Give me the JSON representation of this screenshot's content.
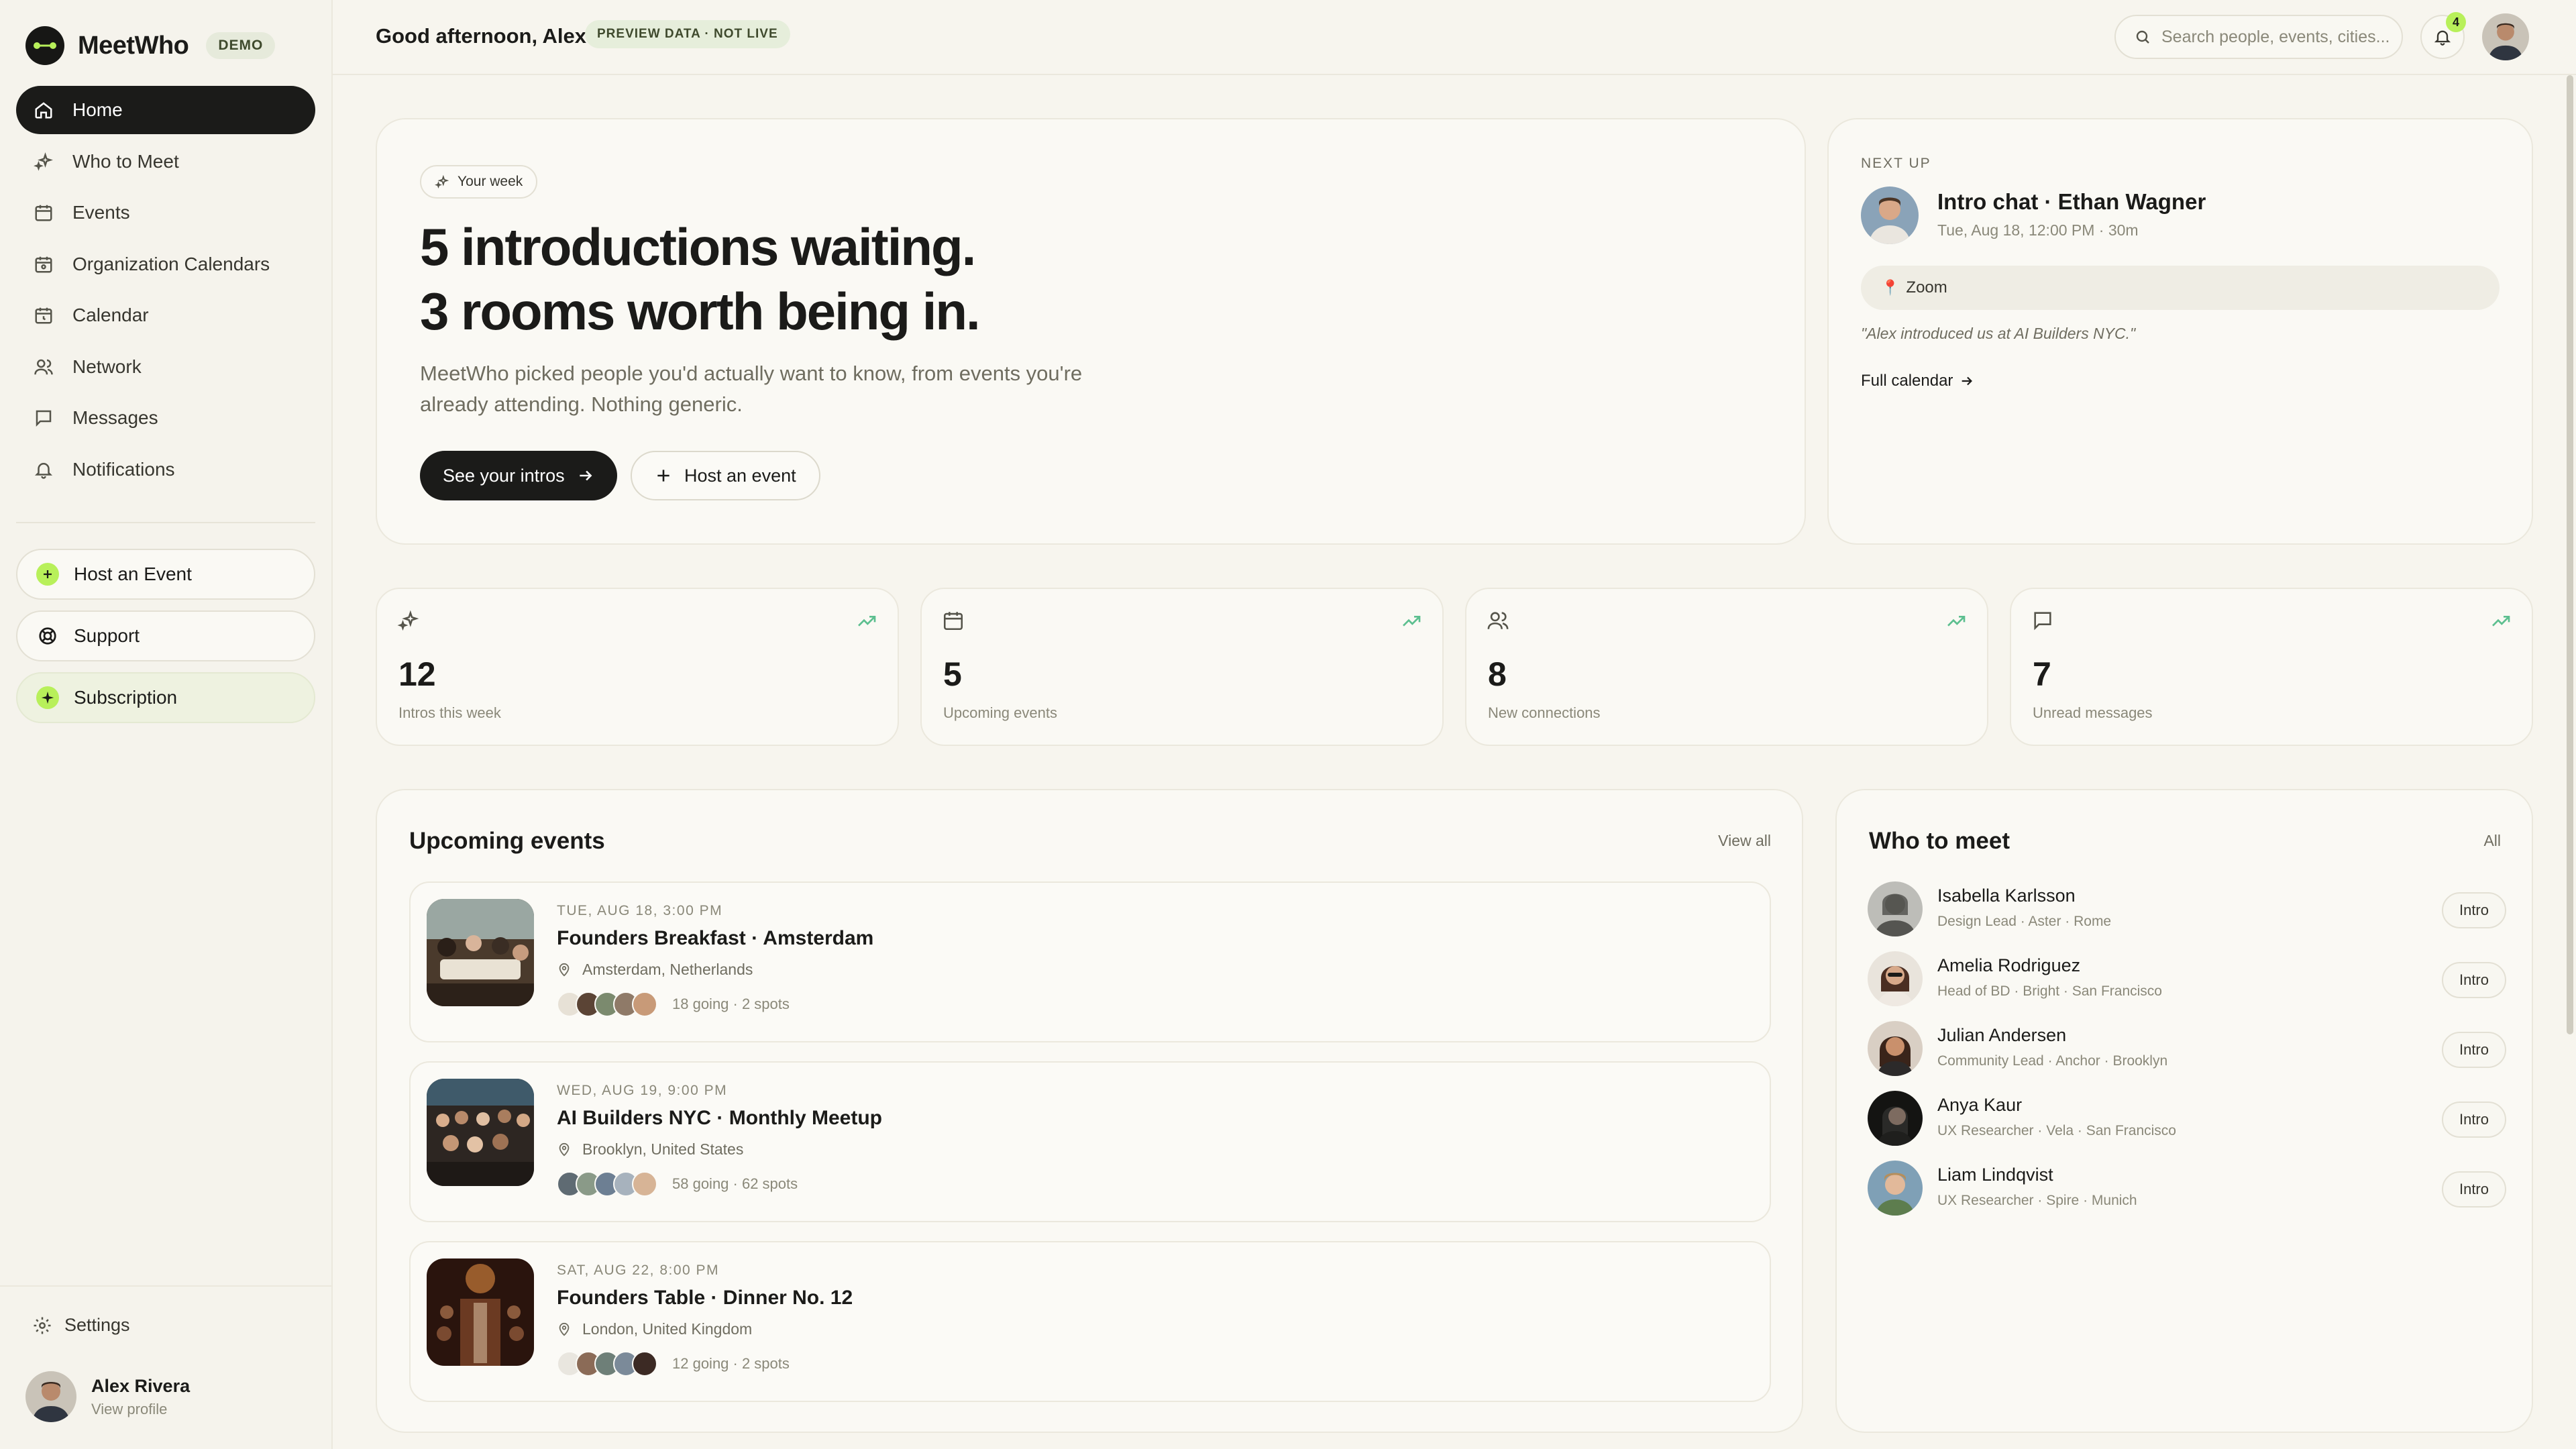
{
  "brand": {
    "name": "MeetWho",
    "badge": "DEMO"
  },
  "sidebar": {
    "items": [
      {
        "label": "Home",
        "icon": "home-icon",
        "active": true
      },
      {
        "label": "Who to Meet",
        "icon": "sparkle-icon"
      },
      {
        "label": "Events",
        "icon": "calendar-icon"
      },
      {
        "label": "Organization Calendars",
        "icon": "org-calendar-icon"
      },
      {
        "label": "Calendar",
        "icon": "calendar-clock-icon"
      },
      {
        "label": "Network",
        "icon": "users-icon"
      },
      {
        "label": "Messages",
        "icon": "message-icon"
      },
      {
        "label": "Notifications",
        "icon": "bell-icon"
      }
    ],
    "host_event": "Host an Event",
    "support": "Support",
    "subscription": "Subscription",
    "settings": "Settings",
    "profile": {
      "name": "Alex Rivera",
      "link": "View profile"
    }
  },
  "topbar": {
    "greeting": "Good afternoon, Alex",
    "preview_badge": "PREVIEW DATA · NOT LIVE",
    "search_placeholder": "Search people, events, cities...",
    "notification_count": "4"
  },
  "hero": {
    "chip": "Your week",
    "title_line1": "5 introductions waiting.",
    "title_line2": "3 rooms worth being in.",
    "description": "MeetWho picked people you'd actually want to know, from events you're already attending. Nothing generic.",
    "primary_button": "See your intros",
    "secondary_button": "Host an event"
  },
  "next_up": {
    "kicker": "NEXT UP",
    "title": "Intro chat · Ethan Wagner",
    "time": "Tue, Aug 18, 12:00 PM · 30m",
    "location": "Zoom",
    "quote": "\"Alex introduced us at AI Builders NYC.\"",
    "link": "Full calendar"
  },
  "stats": [
    {
      "value": "12",
      "label": "Intros this week",
      "icon": "sparkle-icon"
    },
    {
      "value": "5",
      "label": "Upcoming events",
      "icon": "calendar-icon"
    },
    {
      "value": "8",
      "label": "New connections",
      "icon": "users-icon"
    },
    {
      "value": "7",
      "label": "Unread messages",
      "icon": "message-icon"
    }
  ],
  "events": {
    "title": "Upcoming events",
    "view_all": "View all",
    "items": [
      {
        "date": "TUE, AUG 18, 3:00 PM",
        "title": "Founders Breakfast · Amsterdam",
        "location": "Amsterdam, Netherlands",
        "going": "18 going · 2 spots"
      },
      {
        "date": "WED, AUG 19, 9:00 PM",
        "title": "AI Builders NYC · Monthly Meetup",
        "location": "Brooklyn, United States",
        "going": "58 going · 62 spots"
      },
      {
        "date": "SAT, AUG 22, 8:00 PM",
        "title": "Founders Table · Dinner No. 12",
        "location": "London, United Kingdom",
        "going": "12 going · 2 spots"
      }
    ]
  },
  "who_to_meet": {
    "title": "Who to meet",
    "all": "All",
    "intro_label": "Intro",
    "people": [
      {
        "name": "Isabella Karlsson",
        "role": "Design Lead · Aster · Rome"
      },
      {
        "name": "Amelia Rodriguez",
        "role": "Head of BD · Bright · San Francisco"
      },
      {
        "name": "Julian Andersen",
        "role": "Community Lead · Anchor · Brooklyn"
      },
      {
        "name": "Anya Kaur",
        "role": "UX Researcher · Vela · San Francisco"
      },
      {
        "name": "Liam Lindqvist",
        "role": "UX Researcher · Spire · Munich"
      }
    ]
  },
  "colors": {
    "accent": "#b8f05a",
    "dark": "#1b1b19",
    "background": "#f7f5ee",
    "card": "#faf9f4",
    "trend": "#5cbf8f"
  }
}
